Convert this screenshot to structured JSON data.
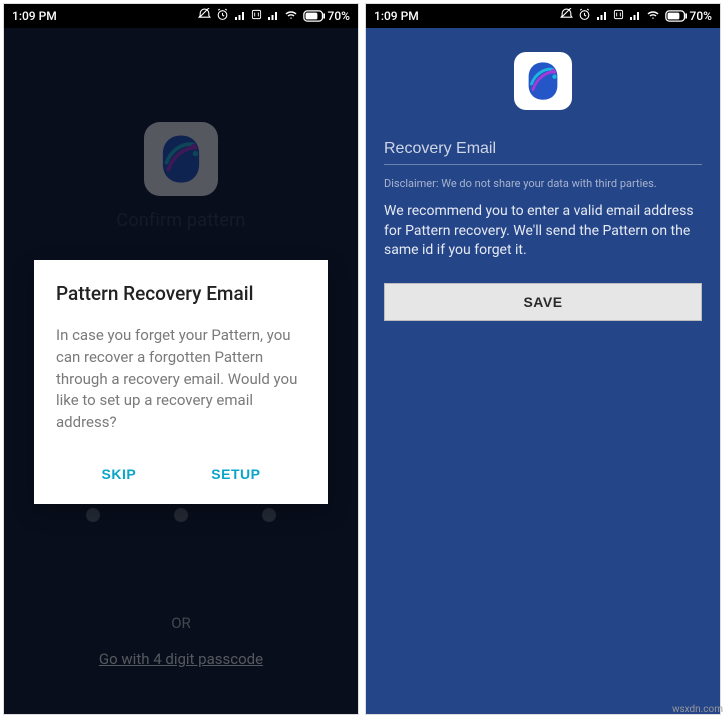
{
  "statusbar": {
    "time": "1:09 PM",
    "battery_pct": "70%"
  },
  "left": {
    "hidden_title": "Confirm pattern",
    "or_label": "OR",
    "passcode_link": "Go with 4 digit passcode",
    "dialog": {
      "title": "Pattern Recovery Email",
      "body": "In case you forget your Pattern, you can recover a forgotten Pattern through a recovery email. Would you like to set up a recovery email address?",
      "skip": "SKIP",
      "setup": "SETUP"
    }
  },
  "right": {
    "email_placeholder": "Recovery Email",
    "disclaimer": "Disclaimer: We do not share your data with third parties.",
    "recommend": "We recommend you to enter a valid email address for Pattern recovery. We'll send the Pattern on the same id if you forget it.",
    "save": "SAVE"
  },
  "watermark": "wsxdn.com"
}
